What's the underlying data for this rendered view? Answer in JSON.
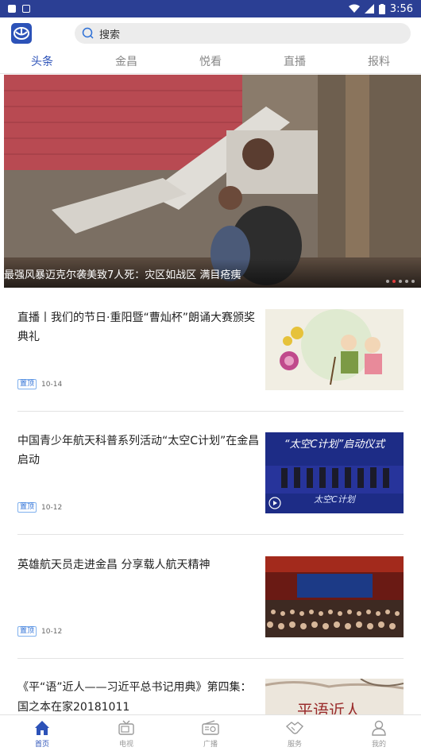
{
  "status_bar": {
    "time": "3:56",
    "battery_icon": "battery-icon"
  },
  "header": {
    "logo_icon": "app-logo-icon",
    "search_placeholder": "搜索"
  },
  "tabs": [
    {
      "label": "头条",
      "active": true
    },
    {
      "label": "金昌",
      "active": false
    },
    {
      "label": "悦看",
      "active": false
    },
    {
      "label": "直播",
      "active": false
    },
    {
      "label": "报料",
      "active": false
    }
  ],
  "hero": {
    "caption": "最强风暴迈克尔袭美致7人死：灾区如战区 满目疮痍",
    "slide_count": 5,
    "active_slide": 2
  },
  "news": [
    {
      "title": "直播丨我们的节日·重阳暨“曹灿杯”朗诵大赛颁奖典礼",
      "badge": "置顶",
      "date": "10-14"
    },
    {
      "title": "中国青少年航天科普系列活动“太空C计划”在金昌启动",
      "badge": "置顶",
      "date": "10-12",
      "thumb_text": "“太空C计划”启动仪式",
      "thumb_sub": "太空C计划"
    },
    {
      "title": "英雄航天员走进金昌 分享载人航天精神",
      "badge": "置顶",
      "date": "10-12"
    },
    {
      "title": "《平“语”近人——习近平总书记用典》第四集：国之本在家20181011",
      "thumb_text": "平语近人"
    }
  ],
  "bottom_nav": [
    {
      "label": "首页",
      "icon": "home-icon",
      "active": true
    },
    {
      "label": "电视",
      "icon": "tv-icon",
      "active": false
    },
    {
      "label": "广播",
      "icon": "radio-icon",
      "active": false
    },
    {
      "label": "服务",
      "icon": "handshake-icon",
      "active": false
    },
    {
      "label": "我的",
      "icon": "user-icon",
      "active": false
    }
  ],
  "colors": {
    "brand": "#2c52b8",
    "status_bar": "#2b3f94",
    "active_dot": "#e03c3c"
  }
}
